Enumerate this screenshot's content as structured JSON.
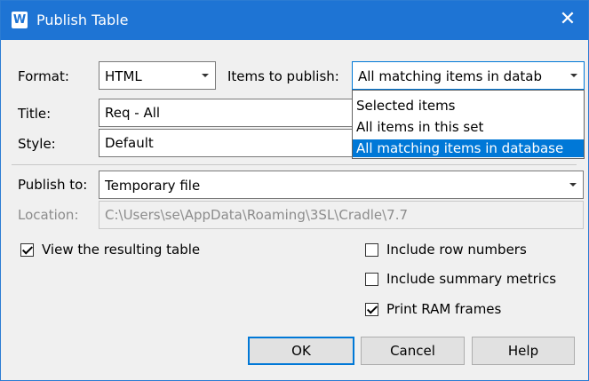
{
  "window": {
    "title": "Publish Table",
    "icon_letter": "W",
    "close_glyph": "✕"
  },
  "format": {
    "label": "Format:",
    "value": "HTML"
  },
  "items": {
    "label": "Items to publish:",
    "value": "All matching items in datab",
    "options": [
      {
        "label": "Selected items",
        "selected": false
      },
      {
        "label": "All items in this set",
        "selected": false
      },
      {
        "label": "All matching items in database",
        "selected": true
      }
    ]
  },
  "title_field": {
    "label": "Title:",
    "value": "Req - All"
  },
  "style_field": {
    "label": "Style:",
    "value": "Default"
  },
  "publish_to": {
    "label": "Publish to:",
    "value": "Temporary file"
  },
  "location": {
    "label": "Location:",
    "value": "C:\\Users\\se\\AppData\\Roaming\\3SL\\Cradle\\7.7"
  },
  "options": {
    "view_result": {
      "label": "View the resulting table",
      "checked": true
    },
    "row_numbers": {
      "label": "Include row numbers",
      "checked": false
    },
    "summary_metrics": {
      "label": "Include summary metrics",
      "checked": false
    },
    "print_ram": {
      "label": "Print RAM frames",
      "checked": true
    }
  },
  "buttons": {
    "ok": "OK",
    "cancel": "Cancel",
    "help": "Help"
  },
  "colors": {
    "titlebar": "#1e74d4",
    "selection": "#0078d7"
  }
}
